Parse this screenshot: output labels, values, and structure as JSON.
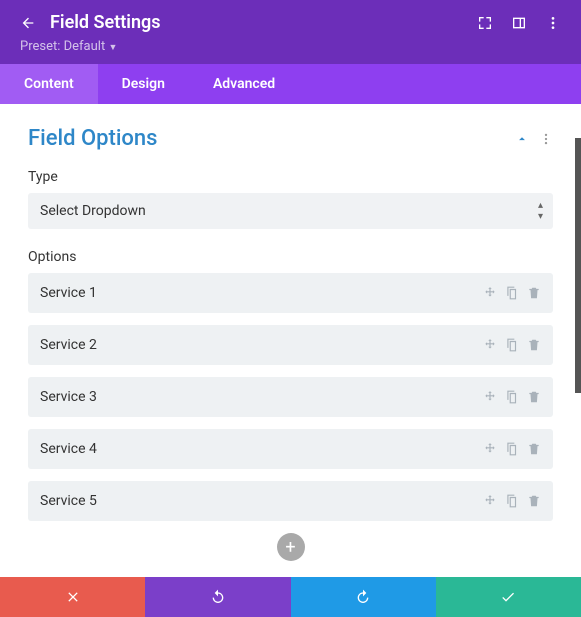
{
  "header": {
    "title": "Field Settings",
    "preset": "Preset: Default"
  },
  "tabs": [
    {
      "label": "Content",
      "active": true
    },
    {
      "label": "Design",
      "active": false
    },
    {
      "label": "Advanced",
      "active": false
    }
  ],
  "section": {
    "title": "Field Options",
    "type_label": "Type",
    "type_value": "Select Dropdown",
    "options_label": "Options",
    "options": [
      {
        "label": "Service 1"
      },
      {
        "label": "Service 2"
      },
      {
        "label": "Service 3"
      },
      {
        "label": "Service 4"
      },
      {
        "label": "Service 5"
      }
    ]
  }
}
